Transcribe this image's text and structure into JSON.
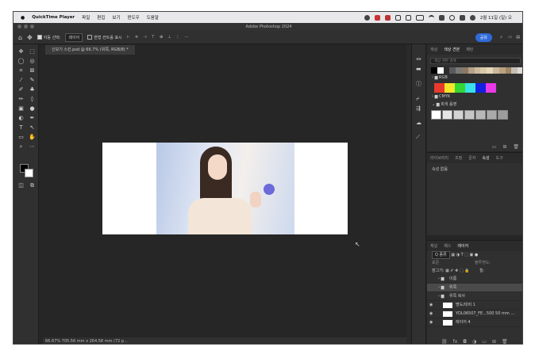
{
  "menubar": {
    "apple": "",
    "app": "QuickTime Player",
    "items": [
      "파일",
      "편집",
      "보기",
      "윈도우",
      "도움말"
    ],
    "datetime": "2월 11일 (일) 오"
  },
  "window": {
    "title": "Adobe Photoshop 2024"
  },
  "options": {
    "auto_select_label": "자동 선택:",
    "auto_select_value": "레이어",
    "transform_label": "변형 컨트롤 표시",
    "share_label": "공유"
  },
  "document": {
    "tab": "신보기 스킨.psd @ 66.7% (위쪽, RGB/8) *",
    "status": "66.67%    705.56 mm x 264.58 mm (72 p..."
  },
  "swatches_panel": {
    "tabs": [
      "색상",
      "색상 견본",
      "패턴"
    ],
    "active_tab": 1,
    "search_placeholder": "색상 견본 검색",
    "groups": [
      "RGB",
      "CMYK",
      "회색 음영"
    ],
    "top_colors": [
      "#000000",
      "#ffffff",
      "#2c2c2c",
      "#5a5a5a",
      "#7a7a7a",
      "#8a7a66",
      "#b6a288",
      "#cdbb9d",
      "#d9c9a8",
      "#e4d6ba",
      "#cbb89a",
      "#b9a27f",
      "#9f8664",
      "#c4c0b8",
      "#e0dcd4"
    ],
    "rgb_colors": [
      "#e83a2c",
      "#f5e629",
      "#33d635",
      "#39e1e6",
      "#1320e0",
      "#e83ae6"
    ],
    "gray_colors": [
      "#ffffff",
      "#e6e6e6",
      "#d4d4d4",
      "#c6c6c6",
      "#b8b8b8",
      "#aaaaaa",
      "#9c9c9c"
    ]
  },
  "properties_panel": {
    "tabs": [
      "라이브러리",
      "조정",
      "문자",
      "속성",
      "도구"
    ],
    "active_tab": 3,
    "empty_text": "속성 없음"
  },
  "layers_panel": {
    "tabs": [
      "채널",
      "패스",
      "레이어"
    ],
    "active_tab": 2,
    "kind_label": "Q 종류",
    "mode_label": "표준",
    "opacity_label": "불투명도:",
    "lock_label": "잠그기:",
    "fill_label": "칠:",
    "layers": [
      {
        "name": "이름",
        "type": "folder"
      },
      {
        "name": "위쪽",
        "type": "folder",
        "selected": true
      },
      {
        "name": "위쪽 복사",
        "type": "folder"
      },
      {
        "name": "명도/대비 1",
        "type": "adjustment"
      },
      {
        "name": "YDL06507_FE...500 50 mm ...",
        "type": "image"
      },
      {
        "name": "레이어 4",
        "type": "image"
      }
    ]
  }
}
